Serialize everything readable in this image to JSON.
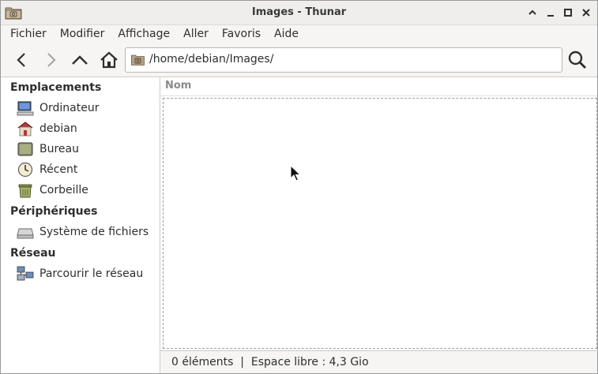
{
  "window": {
    "title": "Images - Thunar"
  },
  "menu": [
    "Fichier",
    "Modifier",
    "Affichage",
    "Aller",
    "Favoris",
    "Aide"
  ],
  "toolbar": {
    "location_path": "/home/debian/Images/"
  },
  "sidebar": {
    "sections": [
      {
        "title": "Emplacements",
        "items": [
          {
            "label": "Ordinateur",
            "icon": "computer-icon"
          },
          {
            "label": "debian",
            "icon": "home-folder-icon"
          },
          {
            "label": "Bureau",
            "icon": "desktop-icon"
          },
          {
            "label": "Récent",
            "icon": "recent-clock-icon"
          },
          {
            "label": "Corbeille",
            "icon": "trash-icon"
          }
        ]
      },
      {
        "title": "Périphériques",
        "items": [
          {
            "label": "Système de fichiers",
            "icon": "drive-icon"
          }
        ]
      },
      {
        "title": "Réseau",
        "items": [
          {
            "label": "Parcourir le réseau",
            "icon": "network-icon"
          }
        ]
      }
    ]
  },
  "main": {
    "column_name": "Nom"
  },
  "status": {
    "text": "0 éléments  |  Espace libre : 4,3 Gio"
  }
}
